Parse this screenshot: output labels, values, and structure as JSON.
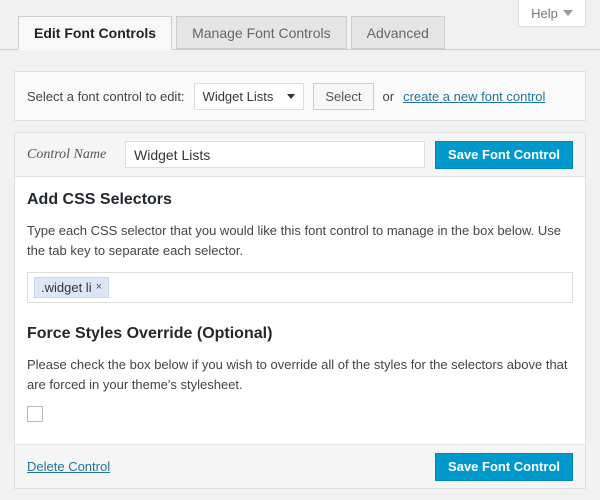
{
  "help": {
    "label": "Help",
    "icon": "chevron-down-icon"
  },
  "tabs": [
    {
      "label": "Edit Font Controls",
      "active": true
    },
    {
      "label": "Manage Font Controls",
      "active": false
    },
    {
      "label": "Advanced",
      "active": false
    }
  ],
  "selector_bar": {
    "label": "Select a font control to edit:",
    "dropdown_value": "Widget Lists",
    "dropdown_icon": "caret-down-icon",
    "select_button": "Select",
    "or_text": "or",
    "create_link": "create a new font control"
  },
  "form": {
    "control_name_label": "Control Name",
    "control_name_value": "Widget Lists",
    "control_name_placeholder": "Control Name",
    "save_button_top": "Save Font Control",
    "save_button_bottom": "Save Font Control",
    "delete_link": "Delete Control"
  },
  "css_selectors": {
    "title": "Add CSS Selectors",
    "description": "Type each CSS selector that you would like this font control to manage in the box below. Use the tab key to separate each selector.",
    "tags": [
      {
        "label": ".widget li",
        "remove_icon": "×"
      }
    ]
  },
  "force_override": {
    "title": "Force Styles Override (Optional)",
    "description": "Please check the box below if you wish to override all of the styles for the selectors above that are forced in your theme's stylesheet.",
    "checked": false
  },
  "colors": {
    "accent_blue": "#0099cc",
    "link_blue": "#21759b",
    "page_bg": "#f1f1f1",
    "tag_bg": "#dbe6f7"
  }
}
